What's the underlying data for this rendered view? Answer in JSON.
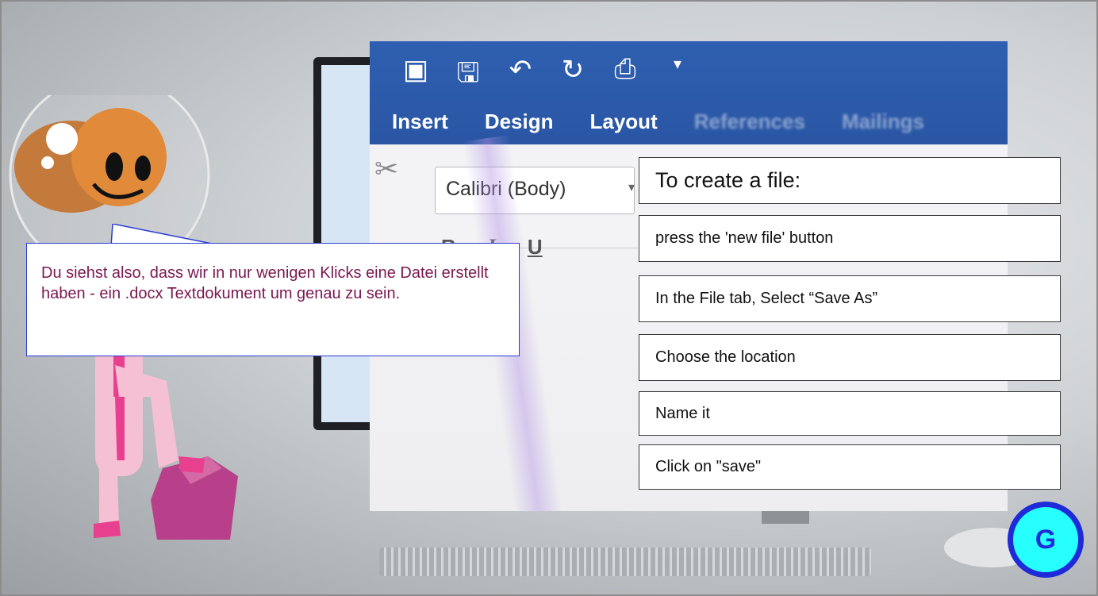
{
  "word_ribbon": {
    "quick_access_icons": [
      "layout-icon",
      "save-icon",
      "undo-icon",
      "redo-icon",
      "print-icon",
      "customize-icon"
    ],
    "tabs": [
      "Insert",
      "Design",
      "Layout",
      "References",
      "Mailings"
    ],
    "font_name": "Calibri (Body)",
    "format_buttons": [
      "B",
      "I",
      "U"
    ]
  },
  "instructions": {
    "title": "To create a file:",
    "steps": [
      "press the 'new file' button",
      "In the File tab, Select “Save As”",
      "Choose the location",
      "Name it",
      "Click on \"save\""
    ]
  },
  "speech_bubble": {
    "text": "Du siehst also, dass wir in nur wenigen Klicks eine Datei erstellt haben - ein  .docx Textdokument um genau zu sein."
  },
  "glossary_button": {
    "label": "G"
  },
  "colors": {
    "ribbon_blue": "#2a56a4",
    "bubble_border": "#2a3bd3",
    "bubble_text": "#7a1850",
    "g_fill": "#27ffff",
    "g_border": "#1f2bd8"
  }
}
